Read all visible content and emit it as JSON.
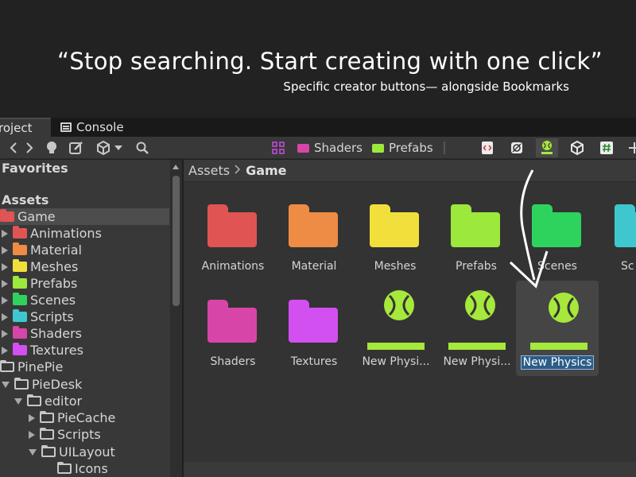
{
  "hero": {
    "title": "“Stop searching. Start creating with one click”",
    "subtitle": "Specific creator buttons— alongside Bookmarks"
  },
  "tabs": [
    {
      "label": "roject"
    },
    {
      "label": "Console",
      "icon": "console-icon"
    }
  ],
  "toolbar": {
    "nav_icons": [
      "chevron-left-icon",
      "chevron-right-icon",
      "lightbulb-icon",
      "edit-icon",
      "unity-cube-icon",
      "dropdown-icon",
      "search-icon"
    ],
    "bookmarks": [
      {
        "label": "Shaders",
        "color": "#d845a8",
        "icon": "folder-icon"
      },
      {
        "label": "Prefabs",
        "color": "#9ce83c",
        "icon": "folder-icon"
      }
    ],
    "bookmark_grid_icon": "grid-icon",
    "creator_buttons": [
      "code-file-icon",
      "physics-material-icon",
      "physic-material-active-icon",
      "unity-cube-icon",
      "csharp-script-icon",
      "add-icon"
    ]
  },
  "sidebar": {
    "favorites": "Favorites",
    "assets": "Assets",
    "items": [
      {
        "label": "Game",
        "color": "#e05454",
        "selected": true
      },
      {
        "label": "Animations",
        "color": "#e05454"
      },
      {
        "label": "Material",
        "color": "#ee8b45"
      },
      {
        "label": "Meshes",
        "color": "#f1e03b"
      },
      {
        "label": "Prefabs",
        "color": "#9ce83c"
      },
      {
        "label": "Scenes",
        "color": "#2ed35e"
      },
      {
        "label": "Scripts",
        "color": "#3fc7cf"
      },
      {
        "label": "Shaders",
        "color": "#d845a8"
      },
      {
        "label": "Textures",
        "color": "#d150ef"
      },
      {
        "label": "PinePie"
      },
      {
        "label": "PieDesk"
      },
      {
        "label": "editor"
      },
      {
        "label": "PieCache"
      },
      {
        "label": "Scripts"
      },
      {
        "label": "UILayout"
      },
      {
        "label": "Icons"
      }
    ]
  },
  "breadcrumb": {
    "root": "Assets",
    "current": "Game"
  },
  "grid": {
    "folders": [
      {
        "label": "Animations",
        "color": "#e05454"
      },
      {
        "label": "Material",
        "color": "#ee8b45"
      },
      {
        "label": "Meshes",
        "color": "#f1e03b"
      },
      {
        "label": "Prefabs",
        "color": "#9ce83c"
      },
      {
        "label": "Scenes",
        "color": "#2ed35e"
      },
      {
        "label": "Sc",
        "color": "#3fc7cf"
      },
      {
        "label": "Shaders",
        "color": "#d845a8"
      },
      {
        "label": "Textures",
        "color": "#d150ef"
      }
    ],
    "physics": [
      {
        "label": "New Physi..."
      },
      {
        "label": "New Physi..."
      },
      {
        "label": "New Physics",
        "editing": true
      }
    ]
  },
  "colors": {
    "accent": "#a6e83c",
    "background": "#222222"
  }
}
